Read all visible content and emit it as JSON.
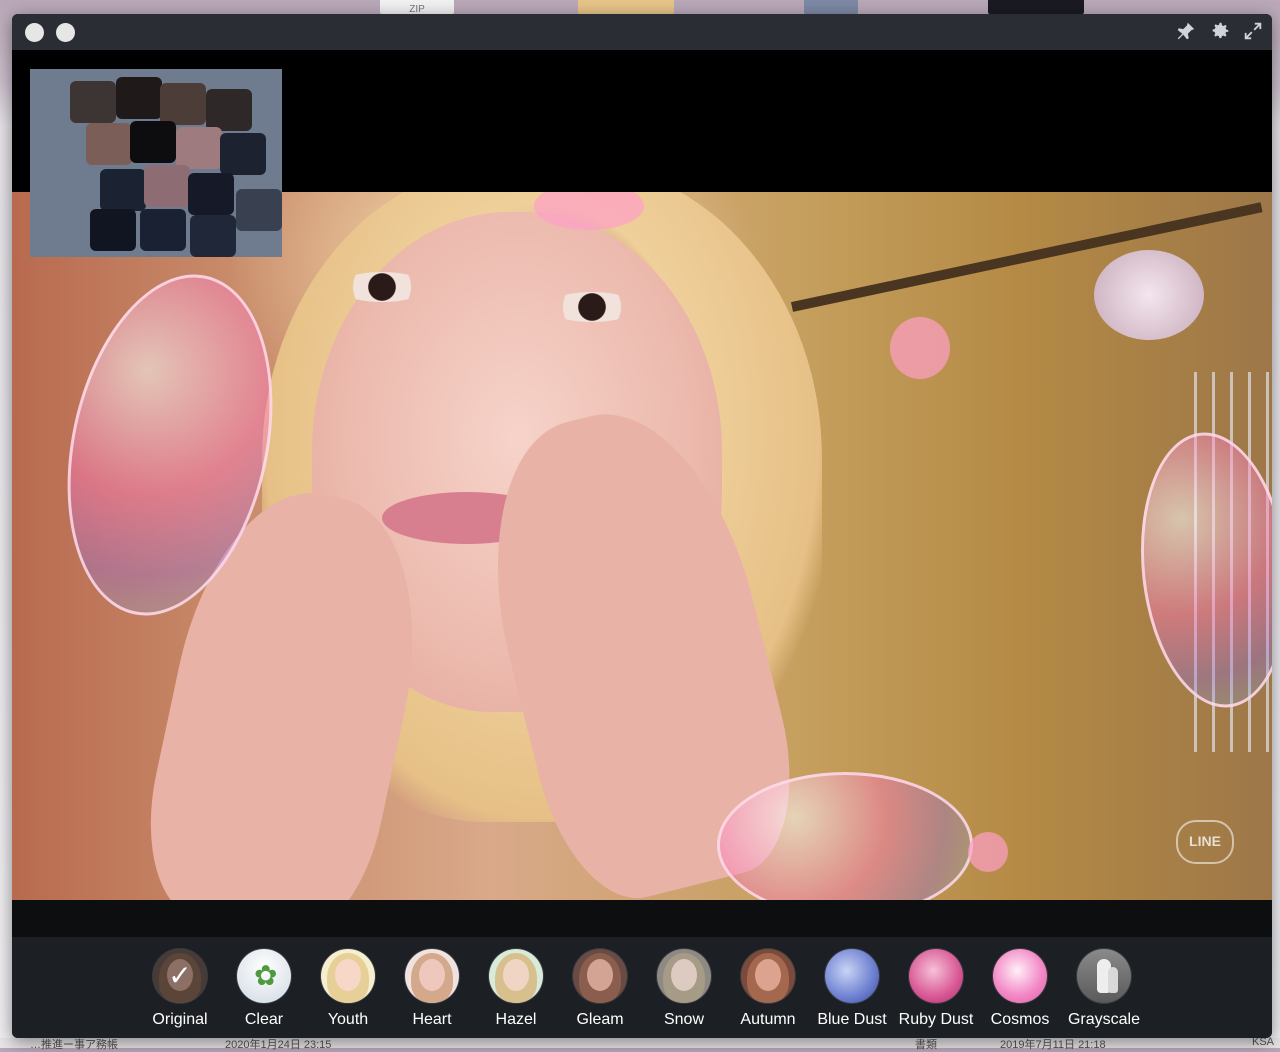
{
  "desktop": {
    "top_thumb_label": "ZIP",
    "footer_texts": [
      "…推進ー事ア務帳",
      "2020年1月24日 23:15",
      "書類",
      "2019年7月11日 21:18",
      "KSA"
    ]
  },
  "window": {
    "titlebar": {
      "pin_icon": "pin-icon",
      "settings_icon": "gear-icon",
      "expand_icon": "expand-icon"
    },
    "video": {
      "watermark": "LINE"
    },
    "filters": [
      {
        "label": "Original",
        "selected": true
      },
      {
        "label": "Clear"
      },
      {
        "label": "Youth"
      },
      {
        "label": "Heart"
      },
      {
        "label": "Hazel"
      },
      {
        "label": "Gleam"
      },
      {
        "label": "Snow"
      },
      {
        "label": "Autumn"
      },
      {
        "label": "Blue Dust"
      },
      {
        "label": "Ruby Dust"
      },
      {
        "label": "Cosmos"
      },
      {
        "label": "Grayscale"
      }
    ]
  }
}
